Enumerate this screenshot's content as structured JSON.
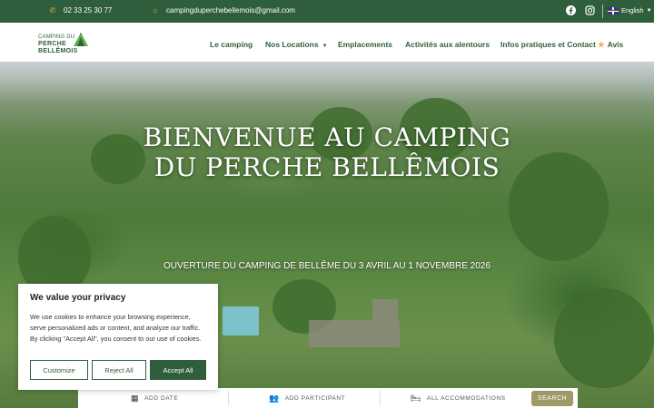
{
  "topbar": {
    "phone": "02 33 25 30 77",
    "email": "campingduperchebellemois@gmail.com",
    "language": "English"
  },
  "logo": {
    "line1": "CAMPING DU",
    "line2": "PERCHE",
    "line3": "BELLÊMOIS"
  },
  "nav": {
    "items": [
      {
        "label": "Le camping"
      },
      {
        "label": "Nos Locations"
      },
      {
        "label": "Emplacements"
      },
      {
        "label": "Activités aux alentours"
      },
      {
        "label": "Infos pratiques et Contact"
      },
      {
        "label": "Avis"
      }
    ]
  },
  "hero": {
    "title_line1": "BIENVENUE AU CAMPING",
    "title_line2": "DU PERCHE BELLÊMOIS",
    "subtitle": "OUVERTURE DU CAMPING DE BELLÊME DU 3 AVRIL AU 1 NOVEMBRE 2026"
  },
  "search": {
    "date_label": "ADD DATE",
    "participant_label": "ADD PARTICIPANT",
    "accommodation_label": "ALL ACCOMMODATIONS",
    "button_label": "SEARCH"
  },
  "cookie": {
    "title": "We value your privacy",
    "text": "We use cookies to enhance your browsing experience, serve personalized ads or content, and analyze our traffic. By clicking \"Accept All\", you consent to our use of cookies.",
    "customize": "Customize",
    "reject": "Reject All",
    "accept": "Accept All"
  },
  "colors": {
    "brand_green": "#2f5e3c",
    "accent_gold": "#f2b233",
    "search_button": "#9e9a68"
  }
}
